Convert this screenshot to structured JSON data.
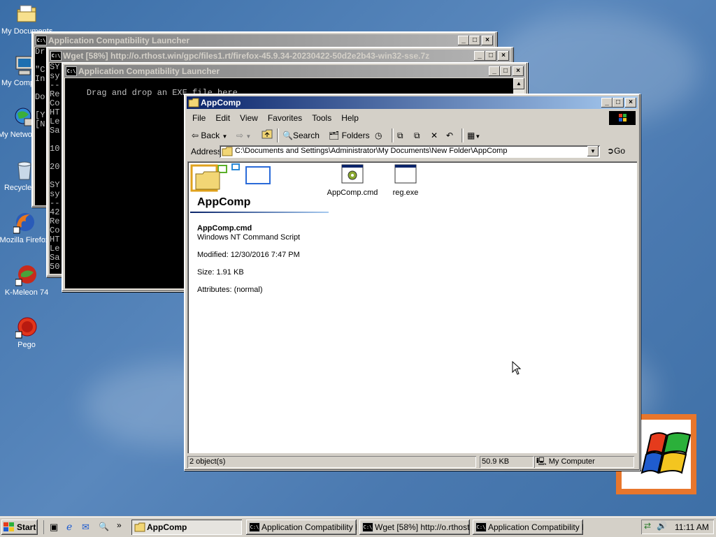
{
  "desktop": {
    "icons": [
      {
        "label": "My Documents"
      },
      {
        "label": "My Computer"
      },
      {
        "label": "My Network Places"
      },
      {
        "label": "Recycle Bin"
      },
      {
        "label": "Mozilla Firefox"
      },
      {
        "label": "K-Meleon 74"
      },
      {
        "label": "Pego"
      }
    ]
  },
  "win_back": {
    "title": "Application Compatibility Launcher",
    "lines": [
      "Dr",
      "",
      "\"C",
      "In",
      "",
      "Do",
      "",
      "[Y",
      "[N"
    ]
  },
  "win_wget": {
    "title": "Wget [58%] http://o.rthost.win/gpc/files1.rt/firefox-45.9.34-20230422-50d2e2b43-win32-sse.7z",
    "lines": [
      "SY",
      "sy",
      "--",
      "Re",
      "Co",
      "HT",
      "Le",
      "Sa",
      "",
      "10",
      "",
      "20",
      "",
      "SY",
      "sy",
      "--",
      "42",
      "Re",
      "Co",
      "HT",
      "Le",
      "Sa",
      "50",
      "",
      "55"
    ]
  },
  "win_launcher": {
    "title": "Application Compatibility Launcher",
    "text": "Drag and drop an EXE file here."
  },
  "explorer": {
    "title": "AppComp",
    "menu": [
      "File",
      "Edit",
      "View",
      "Favorites",
      "Tools",
      "Help"
    ],
    "toolbar": {
      "back": "Back",
      "search": "Search",
      "folders": "Folders"
    },
    "address_label": "Address",
    "address_value": "C:\\Documents and Settings\\Administrator\\My Documents\\New Folder\\AppComp",
    "go_label": "Go",
    "folder_heading": "AppComp",
    "details": {
      "name": "AppComp.cmd",
      "type": "Windows NT Command Script",
      "modified": "Modified: 12/30/2016 7:47 PM",
      "size": "Size: 1.91 KB",
      "attributes": "Attributes: (normal)"
    },
    "files": [
      {
        "name": "AppComp.cmd",
        "icon": "cmd-script-icon"
      },
      {
        "name": "reg.exe",
        "icon": "exe-icon"
      }
    ],
    "status": {
      "objects": "2 object(s)",
      "size": "50.9 KB",
      "zone": "My Computer"
    }
  },
  "taskbar": {
    "start": "Start",
    "tasks": [
      {
        "label": "AppComp",
        "active": true
      },
      {
        "label": "Application Compatibility L...",
        "active": false
      },
      {
        "label": "Wget [58%] http://o.rthost....",
        "active": false
      },
      {
        "label": "Application Compatibility L...",
        "active": false
      }
    ],
    "clock": "11:11 AM"
  },
  "colors": {
    "titlebar_active": "#0a246a",
    "titlebar_inactive": "#808080",
    "desktop": "#3a6ea8",
    "face": "#d4d0c8"
  }
}
